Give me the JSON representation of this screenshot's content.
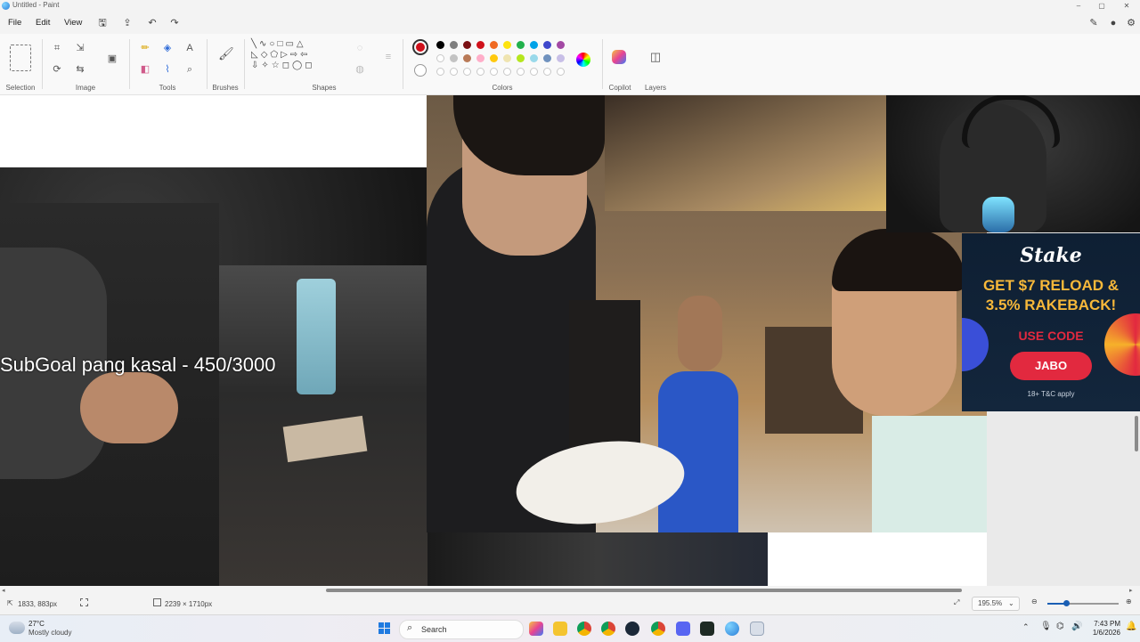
{
  "window": {
    "title": "Untitled - Paint",
    "min": "–",
    "max": "▢",
    "close": "✕"
  },
  "menu": {
    "file": "File",
    "edit": "Edit",
    "view": "View"
  },
  "ribbon_groups": {
    "selection": "Selection",
    "image": "Image",
    "tools": "Tools",
    "brushes": "Brushes",
    "shapes": "Shapes",
    "colors": "Colors",
    "copilot": "Copilot",
    "layers": "Layers"
  },
  "colors": {
    "current": "#d0111b",
    "row1": [
      "#000000",
      "#7f7f7f",
      "#7a1013",
      "#d0111b",
      "#f06a22",
      "#fde30f",
      "#22b14c",
      "#00a2e8",
      "#3f48cc",
      "#a349a4"
    ],
    "row2": [
      "#ffffff",
      "#c3c3c3",
      "#b97a57",
      "#ffaec9",
      "#ffc90e",
      "#efe4b0",
      "#b5e61d",
      "#99d9ea",
      "#7092be",
      "#c8bfe7"
    ]
  },
  "overlay": {
    "subgoal_text": "SubGoal pang kasal - 450/3000"
  },
  "ad": {
    "brand": "Stake",
    "headline1": "GET $7 RELOAD &",
    "headline2": "3.5% RAKEBACK!",
    "use_code": "USE CODE",
    "code": "JABO",
    "disclaimer": "18+ T&C apply"
  },
  "status": {
    "cursor_pos": "1833, 883px",
    "canvas_size": "2239 × 1710px",
    "zoom": "195.5%"
  },
  "taskbar": {
    "weather_temp": "27°C",
    "weather_desc": "Mostly cloudy",
    "search_placeholder": "Search",
    "time": "7:43 PM",
    "date": "1/6/2026"
  }
}
